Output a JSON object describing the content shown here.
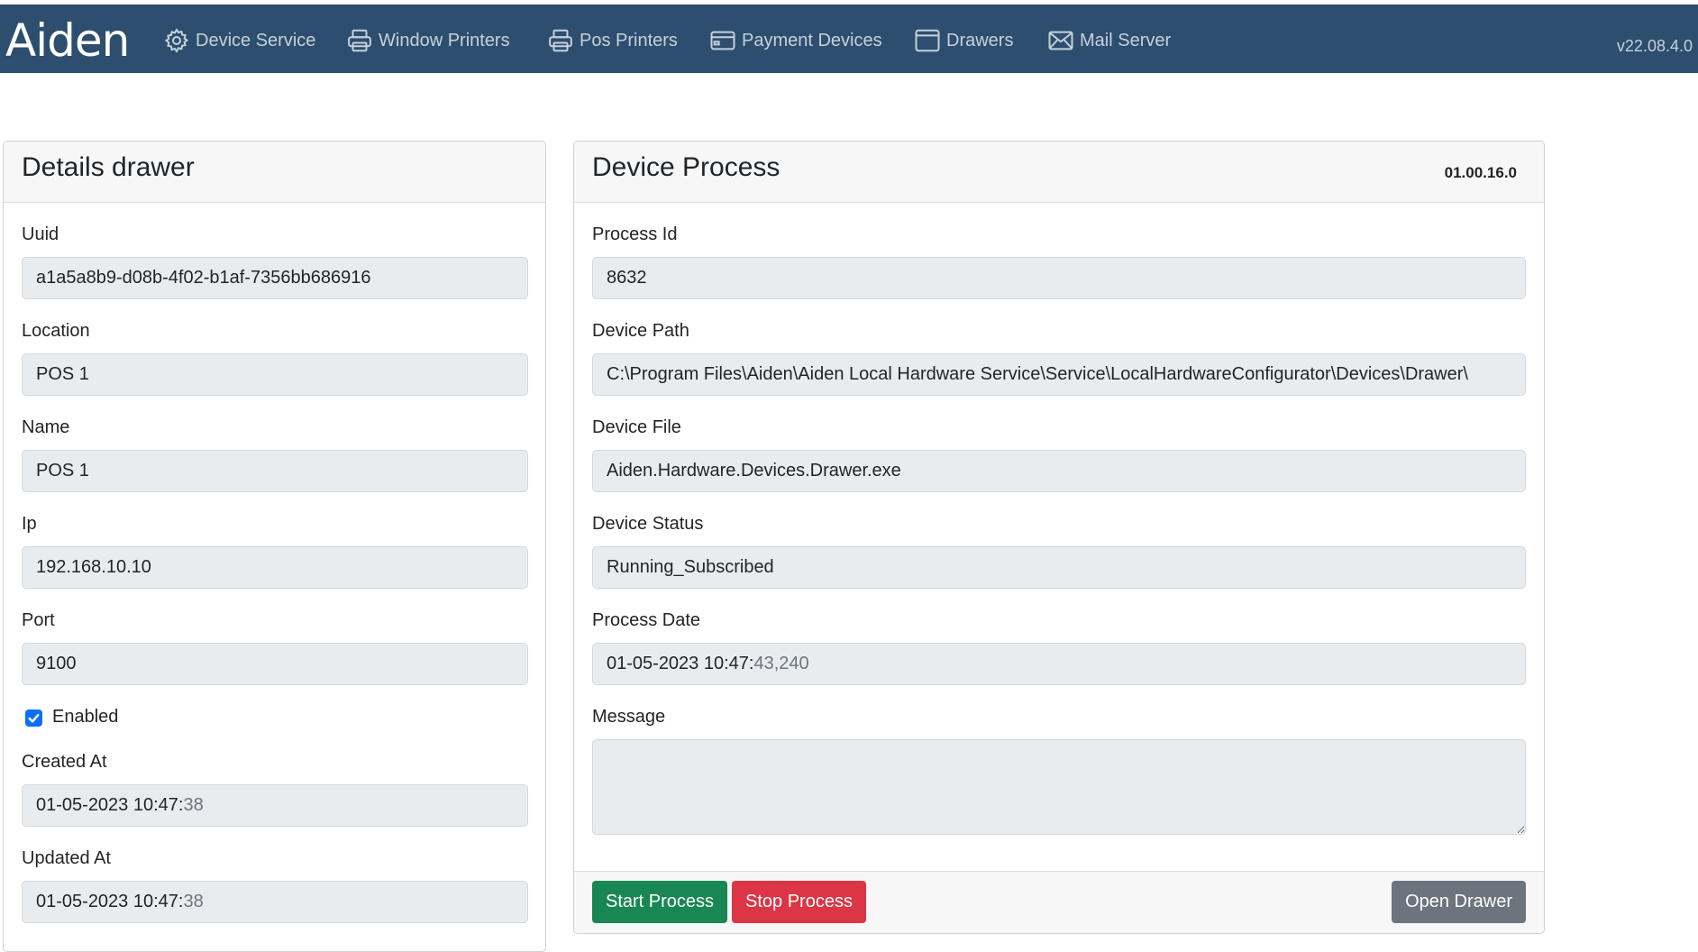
{
  "app": {
    "brand": "Aiden",
    "version": "v22.08.4.0"
  },
  "nav": {
    "items": [
      {
        "label": "Device Service",
        "icon": "gear-icon"
      },
      {
        "label": "Window Printers",
        "icon": "printer-icon"
      },
      {
        "label": "Pos Printers",
        "icon": "printer-icon"
      },
      {
        "label": "Payment Devices",
        "icon": "credit-card-icon"
      },
      {
        "label": "Drawers",
        "icon": "drawer-icon"
      },
      {
        "label": "Mail Server",
        "icon": "envelope-icon"
      }
    ]
  },
  "details": {
    "title": "Details drawer",
    "uuid_label": "Uuid",
    "uuid": "a1a5a8b9-d08b-4f02-b1af-7356bb686916",
    "location_label": "Location",
    "location": "POS 1",
    "name_label": "Name",
    "name": "POS 1",
    "ip_label": "Ip",
    "ip": "192.168.10.10",
    "port_label": "Port",
    "port": "9100",
    "enabled_label": "Enabled",
    "enabled": true,
    "created_label": "Created At",
    "created_main": "01-05-2023 10:47:",
    "created_sec": "38",
    "updated_label": "Updated At",
    "updated_main": "01-05-2023 10:47:",
    "updated_sec": "38"
  },
  "process": {
    "title": "Device Process",
    "version": "01.00.16.0",
    "pid_label": "Process Id",
    "pid": "8632",
    "path_label": "Device Path",
    "path": "C:\\Program Files\\Aiden\\Aiden Local Hardware Service\\Service\\LocalHardwareConfigurator\\Devices\\Drawer\\",
    "file_label": "Device File",
    "file": "Aiden.Hardware.Devices.Drawer.exe",
    "status_label": "Device Status",
    "status": "Running_Subscribed",
    "date_label": "Process Date",
    "date_main": "01-05-2023 10:47:",
    "date_sec": "43,240",
    "message_label": "Message",
    "message": "",
    "start_label": "Start Process",
    "stop_label": "Stop Process",
    "open_label": "Open Drawer"
  },
  "colors": {
    "nav_bg": "#2d4e6e",
    "start": "#198754",
    "stop": "#dc3545",
    "open": "#6c757d",
    "check": "#0d6efd"
  }
}
